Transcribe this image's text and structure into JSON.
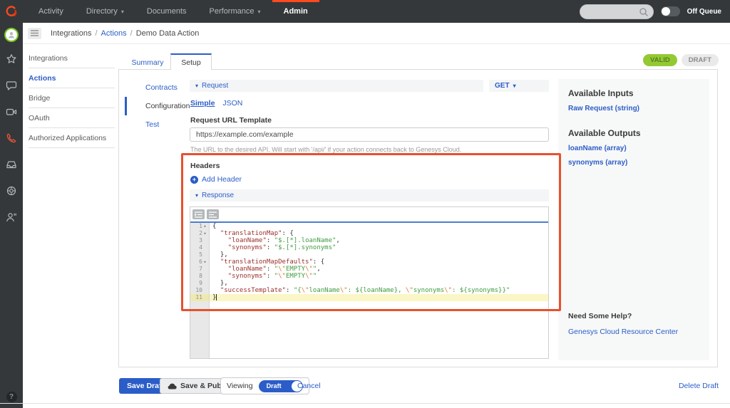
{
  "topbar": {
    "caret": "▾",
    "nav": [
      {
        "label": "Activity",
        "caret": false,
        "active": false
      },
      {
        "label": "Directory",
        "caret": true,
        "active": false
      },
      {
        "label": "Documents",
        "caret": false,
        "active": false
      },
      {
        "label": "Performance",
        "caret": true,
        "active": false
      },
      {
        "label": "Admin",
        "caret": false,
        "active": true
      }
    ],
    "search_value": "",
    "off_queue_label": "Off Queue"
  },
  "left_rail": {
    "icons": [
      "user-avatar",
      "star",
      "chat",
      "video-camera",
      "phone",
      "inbox",
      "gear",
      "agent",
      "help"
    ]
  },
  "breadcrumb": {
    "separator": "/",
    "segments": [
      {
        "label": "Integrations"
      },
      {
        "label": "Actions"
      },
      {
        "label": "Demo Data Action"
      }
    ]
  },
  "side_menu": {
    "items": [
      {
        "label": "Integrations",
        "active": false
      },
      {
        "label": "Actions",
        "active": true
      },
      {
        "label": "Bridge",
        "active": false
      },
      {
        "label": "OAuth",
        "active": false
      },
      {
        "label": "Authorized Applications",
        "active": false
      }
    ]
  },
  "status": {
    "valid_label": "VALID",
    "draft_label": "DRAFT",
    "valid_color": "#94c934",
    "draft_color": "#eaeaea"
  },
  "tabs": {
    "summary": "Summary",
    "setup": "Setup"
  },
  "sub_nav": {
    "items": [
      {
        "label": "Contracts",
        "active": false
      },
      {
        "label": "Configuration",
        "active": true
      },
      {
        "label": "Test",
        "active": false
      }
    ]
  },
  "request": {
    "caret": "▾",
    "section_label": "Request",
    "method": "GET",
    "mode_simple": "Simple",
    "mode_json": "JSON",
    "url_label": "Request URL Template",
    "url_value": "https://example.com/example",
    "url_help": "The URL to the desired API. Will start with '/api/' if your action connects back to Genesys Cloud.",
    "headers_label": "Headers",
    "add_header_label": "Add Header"
  },
  "response": {
    "caret": "▾",
    "section_label": "Response"
  },
  "editor": {
    "lines": [
      {
        "n": "1",
        "fold": true,
        "active": false,
        "tokens": [
          [
            "p",
            "{"
          ]
        ]
      },
      {
        "n": "2",
        "fold": true,
        "active": false,
        "tokens": [
          [
            "p",
            "  "
          ],
          [
            "k",
            "\"translationMap\""
          ],
          [
            "p",
            ": {"
          ]
        ]
      },
      {
        "n": "3",
        "fold": false,
        "active": false,
        "tokens": [
          [
            "p",
            "    "
          ],
          [
            "k",
            "\"loanName\""
          ],
          [
            "p",
            ": "
          ],
          [
            "s",
            "\"$.[*].loanName\""
          ],
          [
            "p",
            ","
          ]
        ]
      },
      {
        "n": "4",
        "fold": false,
        "active": false,
        "tokens": [
          [
            "p",
            "    "
          ],
          [
            "k",
            "\"synonyms\""
          ],
          [
            "p",
            ": "
          ],
          [
            "s",
            "\"$.[*].synonyms\""
          ]
        ]
      },
      {
        "n": "5",
        "fold": false,
        "active": false,
        "tokens": [
          [
            "p",
            "  },"
          ]
        ]
      },
      {
        "n": "6",
        "fold": true,
        "active": false,
        "tokens": [
          [
            "p",
            "  "
          ],
          [
            "k",
            "\"translationMapDefaults\""
          ],
          [
            "p",
            ": {"
          ]
        ]
      },
      {
        "n": "7",
        "fold": false,
        "active": false,
        "tokens": [
          [
            "p",
            "    "
          ],
          [
            "k",
            "\"loanName\""
          ],
          [
            "p",
            ": "
          ],
          [
            "s",
            "\""
          ],
          [
            "e",
            "\\\""
          ],
          [
            "s",
            "EMPTY"
          ],
          [
            "e",
            "\\\""
          ],
          [
            "s",
            "\""
          ],
          [
            "p",
            ","
          ]
        ]
      },
      {
        "n": "8",
        "fold": false,
        "active": false,
        "tokens": [
          [
            "p",
            "    "
          ],
          [
            "k",
            "\"synonyms\""
          ],
          [
            "p",
            ": "
          ],
          [
            "s",
            "\""
          ],
          [
            "e",
            "\\\""
          ],
          [
            "s",
            "EMPTY"
          ],
          [
            "e",
            "\\\""
          ],
          [
            "s",
            "\""
          ]
        ]
      },
      {
        "n": "9",
        "fold": false,
        "active": false,
        "tokens": [
          [
            "p",
            "  },"
          ]
        ]
      },
      {
        "n": "10",
        "fold": false,
        "active": false,
        "tokens": [
          [
            "p",
            "  "
          ],
          [
            "k",
            "\"successTemplate\""
          ],
          [
            "p",
            ": "
          ],
          [
            "s",
            "\"{"
          ],
          [
            "e",
            "\\\""
          ],
          [
            "s",
            "loanName"
          ],
          [
            "e",
            "\\\""
          ],
          [
            "s",
            ": ${loanName}, "
          ],
          [
            "e",
            "\\\""
          ],
          [
            "s",
            "synonyms"
          ],
          [
            "e",
            "\\\""
          ],
          [
            "s",
            ": ${synonyms}}\""
          ]
        ]
      },
      {
        "n": "11",
        "fold": false,
        "active": true,
        "tokens": [
          [
            "p",
            "}"
          ]
        ]
      }
    ]
  },
  "right_panel": {
    "inputs_title": "Available Inputs",
    "inputs": [
      "Raw Request (string)"
    ],
    "outputs_title": "Available Outputs",
    "outputs": [
      "loanName (array)",
      "synonyms (array)"
    ],
    "help_title": "Need Some Help?",
    "help_link": "Genesys Cloud Resource Center"
  },
  "footer": {
    "save_draft": "Save Draft",
    "save_publish": "Save & Publish",
    "viewing_label": "Viewing",
    "viewing_value": "Draft",
    "cancel": "Cancel",
    "delete_draft": "Delete Draft"
  },
  "annotation": {
    "color": "#e8502e"
  }
}
